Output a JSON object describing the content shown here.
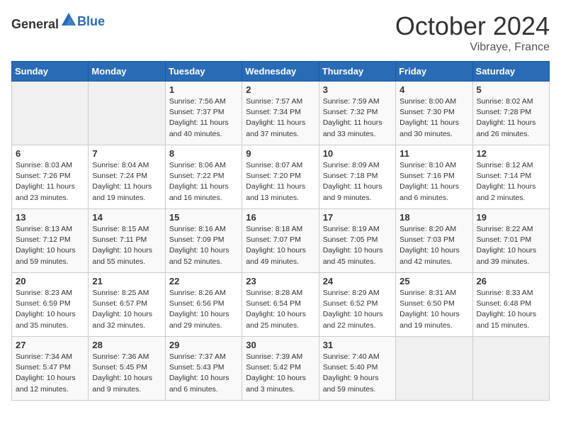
{
  "header": {
    "logo_general": "General",
    "logo_blue": "Blue",
    "month_title": "October 2024",
    "location": "Vibraye, France"
  },
  "weekdays": [
    "Sunday",
    "Monday",
    "Tuesday",
    "Wednesday",
    "Thursday",
    "Friday",
    "Saturday"
  ],
  "weeks": [
    [
      {
        "day": "",
        "sunrise": "",
        "sunset": "",
        "daylight": ""
      },
      {
        "day": "",
        "sunrise": "",
        "sunset": "",
        "daylight": ""
      },
      {
        "day": "1",
        "sunrise": "Sunrise: 7:56 AM",
        "sunset": "Sunset: 7:37 PM",
        "daylight": "Daylight: 11 hours and 40 minutes."
      },
      {
        "day": "2",
        "sunrise": "Sunrise: 7:57 AM",
        "sunset": "Sunset: 7:34 PM",
        "daylight": "Daylight: 11 hours and 37 minutes."
      },
      {
        "day": "3",
        "sunrise": "Sunrise: 7:59 AM",
        "sunset": "Sunset: 7:32 PM",
        "daylight": "Daylight: 11 hours and 33 minutes."
      },
      {
        "day": "4",
        "sunrise": "Sunrise: 8:00 AM",
        "sunset": "Sunset: 7:30 PM",
        "daylight": "Daylight: 11 hours and 30 minutes."
      },
      {
        "day": "5",
        "sunrise": "Sunrise: 8:02 AM",
        "sunset": "Sunset: 7:28 PM",
        "daylight": "Daylight: 11 hours and 26 minutes."
      }
    ],
    [
      {
        "day": "6",
        "sunrise": "Sunrise: 8:03 AM",
        "sunset": "Sunset: 7:26 PM",
        "daylight": "Daylight: 11 hours and 23 minutes."
      },
      {
        "day": "7",
        "sunrise": "Sunrise: 8:04 AM",
        "sunset": "Sunset: 7:24 PM",
        "daylight": "Daylight: 11 hours and 19 minutes."
      },
      {
        "day": "8",
        "sunrise": "Sunrise: 8:06 AM",
        "sunset": "Sunset: 7:22 PM",
        "daylight": "Daylight: 11 hours and 16 minutes."
      },
      {
        "day": "9",
        "sunrise": "Sunrise: 8:07 AM",
        "sunset": "Sunset: 7:20 PM",
        "daylight": "Daylight: 11 hours and 13 minutes."
      },
      {
        "day": "10",
        "sunrise": "Sunrise: 8:09 AM",
        "sunset": "Sunset: 7:18 PM",
        "daylight": "Daylight: 11 hours and 9 minutes."
      },
      {
        "day": "11",
        "sunrise": "Sunrise: 8:10 AM",
        "sunset": "Sunset: 7:16 PM",
        "daylight": "Daylight: 11 hours and 6 minutes."
      },
      {
        "day": "12",
        "sunrise": "Sunrise: 8:12 AM",
        "sunset": "Sunset: 7:14 PM",
        "daylight": "Daylight: 11 hours and 2 minutes."
      }
    ],
    [
      {
        "day": "13",
        "sunrise": "Sunrise: 8:13 AM",
        "sunset": "Sunset: 7:12 PM",
        "daylight": "Daylight: 10 hours and 59 minutes."
      },
      {
        "day": "14",
        "sunrise": "Sunrise: 8:15 AM",
        "sunset": "Sunset: 7:11 PM",
        "daylight": "Daylight: 10 hours and 55 minutes."
      },
      {
        "day": "15",
        "sunrise": "Sunrise: 8:16 AM",
        "sunset": "Sunset: 7:09 PM",
        "daylight": "Daylight: 10 hours and 52 minutes."
      },
      {
        "day": "16",
        "sunrise": "Sunrise: 8:18 AM",
        "sunset": "Sunset: 7:07 PM",
        "daylight": "Daylight: 10 hours and 49 minutes."
      },
      {
        "day": "17",
        "sunrise": "Sunrise: 8:19 AM",
        "sunset": "Sunset: 7:05 PM",
        "daylight": "Daylight: 10 hours and 45 minutes."
      },
      {
        "day": "18",
        "sunrise": "Sunrise: 8:20 AM",
        "sunset": "Sunset: 7:03 PM",
        "daylight": "Daylight: 10 hours and 42 minutes."
      },
      {
        "day": "19",
        "sunrise": "Sunrise: 8:22 AM",
        "sunset": "Sunset: 7:01 PM",
        "daylight": "Daylight: 10 hours and 39 minutes."
      }
    ],
    [
      {
        "day": "20",
        "sunrise": "Sunrise: 8:23 AM",
        "sunset": "Sunset: 6:59 PM",
        "daylight": "Daylight: 10 hours and 35 minutes."
      },
      {
        "day": "21",
        "sunrise": "Sunrise: 8:25 AM",
        "sunset": "Sunset: 6:57 PM",
        "daylight": "Daylight: 10 hours and 32 minutes."
      },
      {
        "day": "22",
        "sunrise": "Sunrise: 8:26 AM",
        "sunset": "Sunset: 6:56 PM",
        "daylight": "Daylight: 10 hours and 29 minutes."
      },
      {
        "day": "23",
        "sunrise": "Sunrise: 8:28 AM",
        "sunset": "Sunset: 6:54 PM",
        "daylight": "Daylight: 10 hours and 25 minutes."
      },
      {
        "day": "24",
        "sunrise": "Sunrise: 8:29 AM",
        "sunset": "Sunset: 6:52 PM",
        "daylight": "Daylight: 10 hours and 22 minutes."
      },
      {
        "day": "25",
        "sunrise": "Sunrise: 8:31 AM",
        "sunset": "Sunset: 6:50 PM",
        "daylight": "Daylight: 10 hours and 19 minutes."
      },
      {
        "day": "26",
        "sunrise": "Sunrise: 8:33 AM",
        "sunset": "Sunset: 6:48 PM",
        "daylight": "Daylight: 10 hours and 15 minutes."
      }
    ],
    [
      {
        "day": "27",
        "sunrise": "Sunrise: 7:34 AM",
        "sunset": "Sunset: 5:47 PM",
        "daylight": "Daylight: 10 hours and 12 minutes."
      },
      {
        "day": "28",
        "sunrise": "Sunrise: 7:36 AM",
        "sunset": "Sunset: 5:45 PM",
        "daylight": "Daylight: 10 hours and 9 minutes."
      },
      {
        "day": "29",
        "sunrise": "Sunrise: 7:37 AM",
        "sunset": "Sunset: 5:43 PM",
        "daylight": "Daylight: 10 hours and 6 minutes."
      },
      {
        "day": "30",
        "sunrise": "Sunrise: 7:39 AM",
        "sunset": "Sunset: 5:42 PM",
        "daylight": "Daylight: 10 hours and 3 minutes."
      },
      {
        "day": "31",
        "sunrise": "Sunrise: 7:40 AM",
        "sunset": "Sunset: 5:40 PM",
        "daylight": "Daylight: 9 hours and 59 minutes."
      },
      {
        "day": "",
        "sunrise": "",
        "sunset": "",
        "daylight": ""
      },
      {
        "day": "",
        "sunrise": "",
        "sunset": "",
        "daylight": ""
      }
    ]
  ]
}
